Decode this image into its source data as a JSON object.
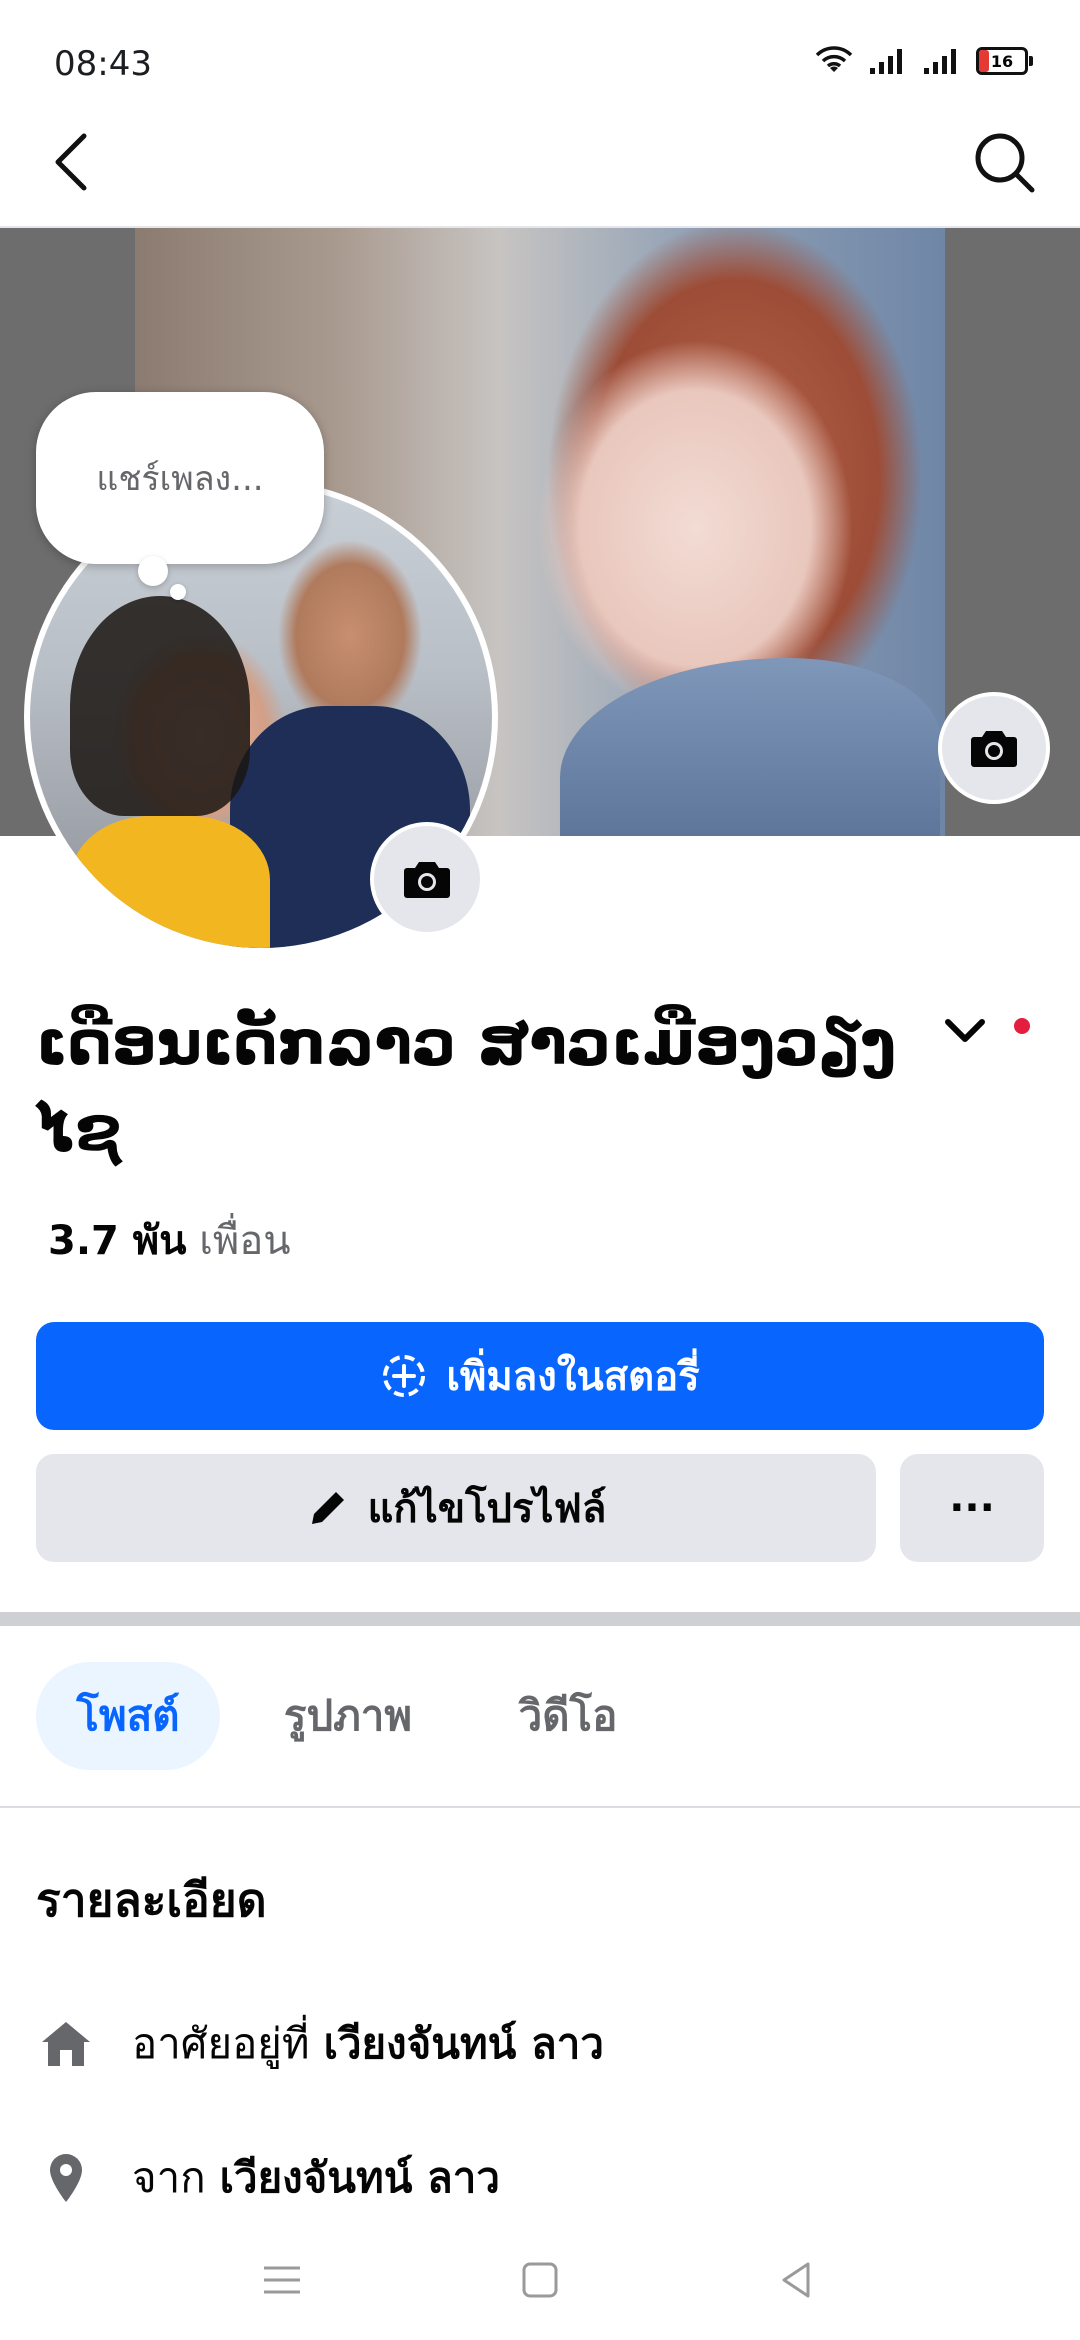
{
  "status_bar": {
    "time": "08:43",
    "battery": "16"
  },
  "header": {
    "back_icon": "chevron-left-icon",
    "search_icon": "search-icon"
  },
  "note": {
    "text": "แชร์เพลง..."
  },
  "profile": {
    "name": "ເດືອນເດັກລາວ ສາວເມືອງວຽງໄຊ",
    "friends_count": "3.7 พัน",
    "friends_label": "เพื่อน"
  },
  "actions": {
    "add_story": "เพิ่มลงในสตอรี่",
    "edit_profile": "แก้ไขโปรไฟล์",
    "more": "···"
  },
  "tabs": [
    {
      "label": "โพสต์",
      "active": true
    },
    {
      "label": "รูปภาพ",
      "active": false
    },
    {
      "label": "วิดีโอ",
      "active": false
    }
  ],
  "details": {
    "title": "รายละเอียด",
    "lives_in_prefix": "อาศัยอยู่ที่",
    "lives_in_value": "เวียงจันทน์ ลาว",
    "from_prefix": "จาก",
    "from_value": "เวียงจันทน์ ลาว"
  },
  "colors": {
    "accent": "#0866ff",
    "button_gray": "#e4e6eb",
    "notification_dot": "#e41e3f",
    "active_tab_bg": "#ebf5ff"
  }
}
